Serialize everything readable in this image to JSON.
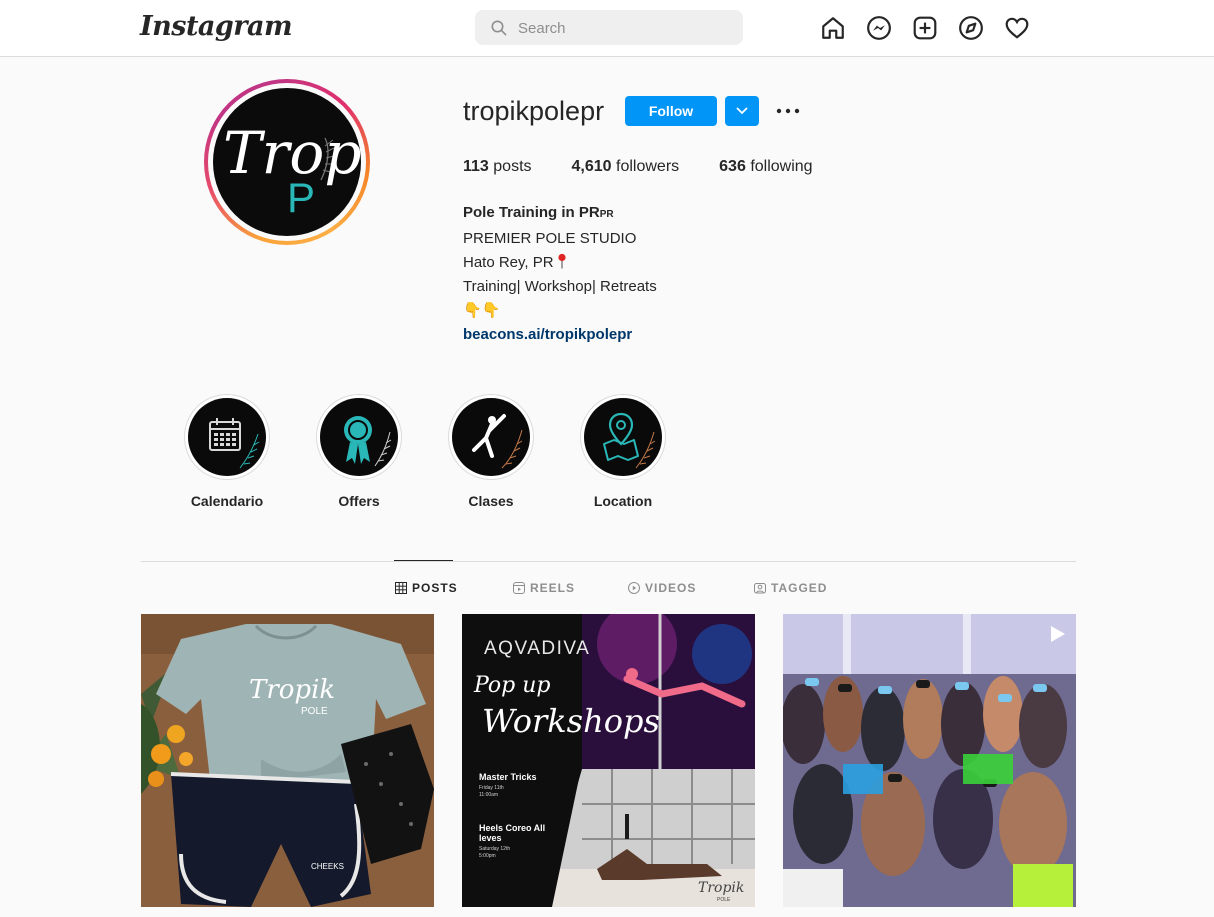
{
  "app": {
    "logo": "Instagram"
  },
  "search": {
    "placeholder": "Search"
  },
  "nav_icons": [
    "home-icon",
    "messenger-icon",
    "new-post-icon",
    "explore-icon",
    "activity-heart-icon"
  ],
  "profile": {
    "username": "tropikpolepr",
    "follow_label": "Follow",
    "avatar_text": {
      "tropik": "Tropik",
      "p": "P"
    },
    "stats": {
      "posts_count": "113",
      "posts_label": "posts",
      "followers_count": "4,610",
      "followers_label": "followers",
      "following_count": "636",
      "following_label": "following"
    },
    "bio": {
      "name": "Pole Training in PR",
      "name_suffix": "PR",
      "line1": "PREMIER POLE STUDIO",
      "line2": "Hato Rey, PR",
      "line3": "Training| Workshop| Retreats",
      "line4": "👇👇",
      "link": "beacons.ai/tropikpolepr"
    }
  },
  "highlights": [
    {
      "label": "Calendario",
      "icon": "calendar-icon"
    },
    {
      "label": "Offers",
      "icon": "award-ribbon-icon"
    },
    {
      "label": "Clases",
      "icon": "pole-pose-icon"
    },
    {
      "label": "Location",
      "icon": "map-pin-icon"
    }
  ],
  "tabs": [
    {
      "label": "POSTS",
      "icon": "grid-icon",
      "active": true
    },
    {
      "label": "REELS",
      "icon": "reels-icon",
      "active": false
    },
    {
      "label": "VIDEOS",
      "icon": "play-icon",
      "active": false
    },
    {
      "label": "TAGGED",
      "icon": "tag-icon",
      "active": false
    }
  ],
  "posts": [
    {
      "shirt_text": "Tropik",
      "shirt_sub": "POLE",
      "shorts_text": "CHEEKS"
    },
    {
      "brand": "AQVADIVA",
      "title1": "Pop up",
      "title2": "Workshops",
      "event1_title": "Master Tricks",
      "event1_date": "Friday 11th",
      "event1_time": "11:00am",
      "event2_title": "Heels Coreo All",
      "event2_title2": "leves",
      "event2_date": "Saturday 12th",
      "event2_time": "5:00pm",
      "logo": "Tropik",
      "logo_sub": "POLE"
    },
    {
      "type": "video"
    }
  ],
  "colors": {
    "accent": "#0095f6",
    "link": "#00376b",
    "teal": "#2ab7b7"
  }
}
